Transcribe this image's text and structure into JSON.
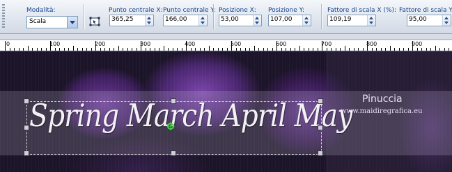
{
  "toolbar": {
    "mode_label": "Modalità:",
    "mode_value": "Scala",
    "center_x_label": "Punto centrale X:",
    "center_x_value": "365,25",
    "center_y_label": "Punto centrale Y:",
    "center_y_value": "166,00",
    "pos_x_label": "Posizione X:",
    "pos_x_value": "53,00",
    "pos_y_label": "Posizione Y:",
    "pos_y_value": "107,00",
    "scale_x_label": "Fattore di scala X (%):",
    "scale_x_value": "109,19",
    "scale_y_label": "Fattore di scala Y n",
    "scale_y_value": "95,00",
    "tool_icon": "pick-tool-icon"
  },
  "ruler": {
    "labels": [
      "0",
      "100",
      "200",
      "300",
      "400",
      "500",
      "600",
      "700",
      "800",
      "900"
    ]
  },
  "canvas": {
    "headline": "Spring March April May",
    "watermark_name": "Pinuccia",
    "watermark_url": "www.maidiregrafica.eu"
  }
}
